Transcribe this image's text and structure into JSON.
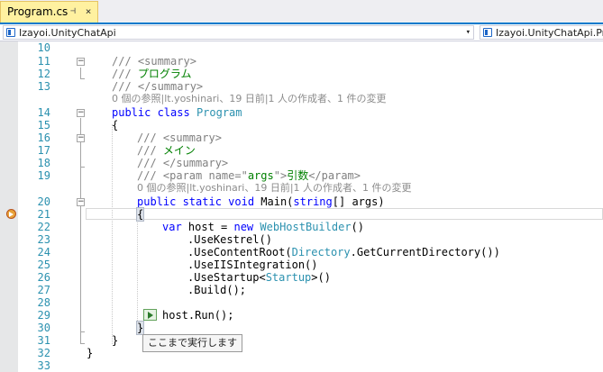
{
  "tab": {
    "name": "Program.cs",
    "pin_glyph": "⊣",
    "close_glyph": "×"
  },
  "nav": {
    "project": "Izayoi.UnityChatApi",
    "scope": "Izayoi.UnityChatApi.Pro",
    "arrow": "▾"
  },
  "lines": {
    "ln10": "10",
    "ln11": "11",
    "ln12": "12",
    "ln13": "13",
    "ln14": "14",
    "ln15": "15",
    "ln16": "16",
    "ln17": "17",
    "ln18": "18",
    "ln19": "19",
    "ln20": "20",
    "ln21": "21",
    "ln22": "22",
    "ln23": "23",
    "ln24": "24",
    "ln25": "25",
    "ln26": "26",
    "ln27": "27",
    "ln28": "28",
    "ln29": "29",
    "ln30": "30",
    "ln31": "31",
    "ln32": "32",
    "ln33": "33"
  },
  "code": {
    "l11": "/// <summary>",
    "l12_prefix": "/// ",
    "l12_text": "プログラム",
    "l13": "/// </summary>",
    "lens1": "0 個の参照|lt.yoshinari、19 日前|1 人の作成者、1 件の変更",
    "l14_kw": "public class",
    "l14_type": "Program",
    "l15": "{",
    "l16": "/// <summary>",
    "l17_prefix": "/// ",
    "l17_text": "メイン",
    "l18": "/// </summary>",
    "l19_a": "/// <param name=\"",
    "l19_b": "args",
    "l19_c": "\">",
    "l19_d": "引数",
    "l19_e": "</param>",
    "lens2": "0 個の参照|lt.yoshinari、19 日前|1 人の作成者、1 件の変更",
    "l20_kw": "public static void",
    "l20_name": " Main(",
    "l20_kw2": "string",
    "l20_rest": "[] args)",
    "l21": "{",
    "l22_kw": "var",
    "l22_a": " host = ",
    "l22_kw2": "new",
    "l22_type": " WebHostBuilder",
    "l22_b": "()",
    "l23": ".UseKestrel()",
    "l24_a": ".UseContentRoot(",
    "l24_type": "Directory",
    "l24_b": ".GetCurrentDirectory())",
    "l25": ".UseIISIntegration()",
    "l26_a": ".UseStartup<",
    "l26_type": "Startup",
    "l26_b": ">()",
    "l27": ".Build();",
    "l29": "host.Run();",
    "l30": "}",
    "l31": "}",
    "l32": "}"
  },
  "tooltip": "ここまで実行します",
  "colors": {
    "keyword": "#0000ff",
    "type": "#2b91af",
    "comment": "#008000",
    "accent": "#007acc"
  }
}
